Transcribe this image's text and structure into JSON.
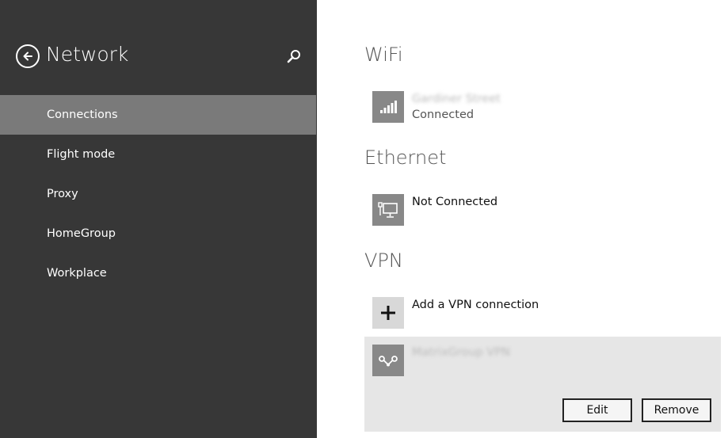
{
  "sidebar": {
    "title": "Network",
    "nav_items": [
      {
        "label": "Connections",
        "selected": true
      },
      {
        "label": "Flight mode",
        "selected": false
      },
      {
        "label": "Proxy",
        "selected": false
      },
      {
        "label": "HomeGroup",
        "selected": false
      },
      {
        "label": "Workplace",
        "selected": false
      }
    ]
  },
  "wifi": {
    "title": "WiFi",
    "network_name": "Gardiner Street",
    "status": "Connected"
  },
  "ethernet": {
    "title": "Ethernet",
    "status": "Not Connected"
  },
  "vpn": {
    "title": "VPN",
    "add_label": "Add a VPN connection",
    "connection_name": "MatrixGroup VPN",
    "edit_label": "Edit",
    "remove_label": "Remove"
  },
  "icons": {
    "back": "back-arrow-icon",
    "search": "search-icon",
    "wifi": "wifi-signal-icon",
    "ethernet": "ethernet-icon",
    "add": "plus-icon",
    "vpn": "vpn-icon"
  },
  "colors": {
    "sidebar_bg": "#373737",
    "selected_nav_bg": "#7a7a7a",
    "tile_bg": "#888888",
    "vpn_panel_bg": "#e6e6e6"
  }
}
